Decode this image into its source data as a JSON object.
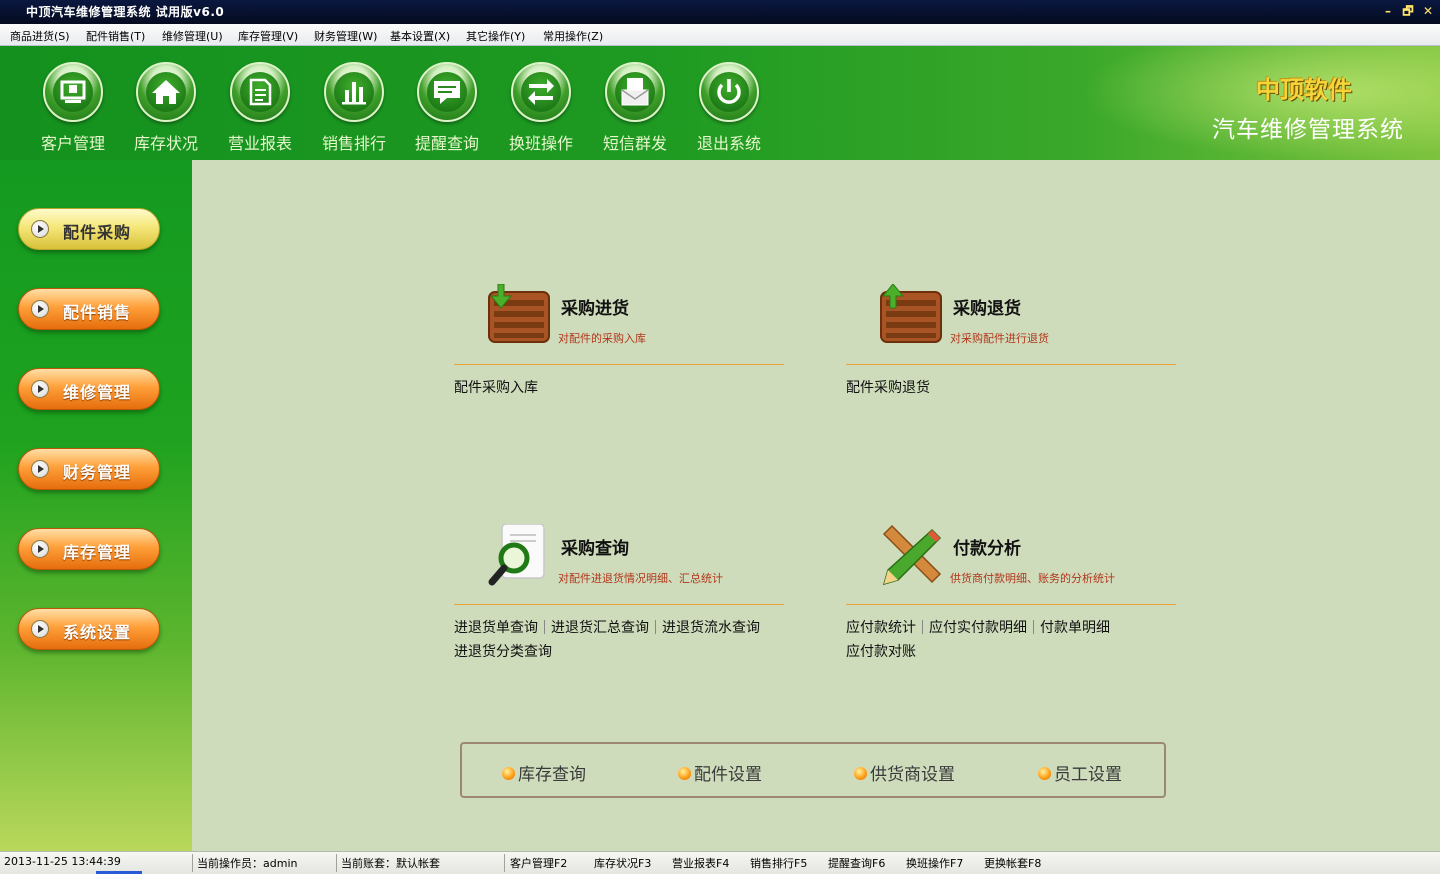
{
  "window": {
    "title": "中顶汽车维修管理系统  试用版v6.0",
    "minimize": "–",
    "restore": "🗗",
    "close": "✕"
  },
  "menu": [
    "商品进货(S)",
    "配件销售(T)",
    "维修管理(U)",
    "库存管理(V)",
    "财务管理(W)",
    "基本设置(X)",
    "其它操作(Y)",
    "常用操作(Z)"
  ],
  "toolbar": [
    {
      "label": "客户管理",
      "icon": "monitor-icon"
    },
    {
      "label": "库存状况",
      "icon": "home-icon"
    },
    {
      "label": "营业报表",
      "icon": "document-icon"
    },
    {
      "label": "销售排行",
      "icon": "bar-chart-icon"
    },
    {
      "label": "提醒查询",
      "icon": "message-icon"
    },
    {
      "label": "换班操作",
      "icon": "swap-icon"
    },
    {
      "label": "短信群发",
      "icon": "envelope-icon"
    },
    {
      "label": "退出系统",
      "icon": "power-icon"
    }
  ],
  "brand": {
    "name": "中顶软件",
    "subtitle": "汽车维修管理系统"
  },
  "sidebar": [
    {
      "label": "配件采购",
      "style": "yellow"
    },
    {
      "label": "配件销售",
      "style": "orange"
    },
    {
      "label": "维修管理",
      "style": "orange"
    },
    {
      "label": "财务管理",
      "style": "orange"
    },
    {
      "label": "库存管理",
      "style": "orange"
    },
    {
      "label": "系统设置",
      "style": "orange"
    }
  ],
  "features": [
    {
      "title": "采购进货",
      "desc": "对配件的采购入库",
      "icon": "crate-in-icon",
      "links": [
        "配件采购入库"
      ]
    },
    {
      "title": "采购退货",
      "desc": "对采购配件进行退货",
      "icon": "crate-out-icon",
      "links": [
        "配件采购退货"
      ]
    },
    {
      "title": "采购查询",
      "desc": "对配件进退货情况明细、汇总统计",
      "icon": "magnifier-icon",
      "links": [
        "进退货单查询",
        "进退货汇总查询",
        "进退货流水查询",
        "进退货分类查询"
      ]
    },
    {
      "title": "付款分析",
      "desc": "供货商付款明细、账务的分析统计",
      "icon": "pencil-ruler-icon",
      "links": [
        "应付款统计",
        "应付实付款明细",
        "付款单明细",
        "应付款对账"
      ]
    }
  ],
  "quick_links": [
    "库存查询",
    "配件设置",
    "供货商设置",
    "员工设置"
  ],
  "status": {
    "datetime": "2013-11-25 13:44:39",
    "operator": "当前操作员：admin",
    "account": "当前账套：默认帐套",
    "fkeys": [
      "客户管理F2",
      "库存状况F3",
      "营业报表F4",
      "销售排行F5",
      "提醒查询F6",
      "换班操作F7",
      "更换帐套F8"
    ]
  },
  "colors": {
    "header_green": "#1e9a22",
    "content_bg": "#cfdcbc",
    "desc_red": "#b1361a",
    "divider_orange": "#e8a23a",
    "brand_gold": "#f4d63b"
  }
}
